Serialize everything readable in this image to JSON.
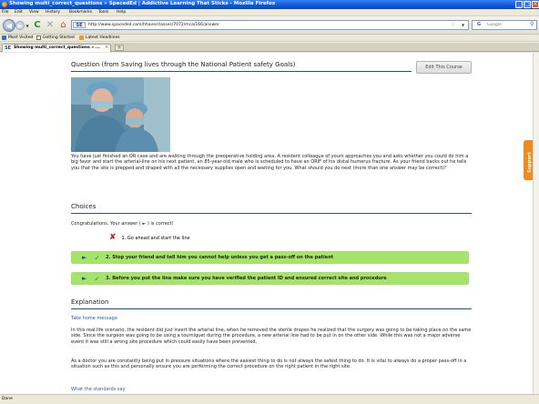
{
  "window": {
    "title": "Showing multi_correct_questions » SpacedEd | Addictive Learning That Sticks - Mozilla Firefox",
    "controls": [
      "_",
      "□",
      "×"
    ]
  },
  "menu": [
    "File",
    "Edit",
    "View",
    "History",
    "Bookmarks",
    "Tools",
    "Help"
  ],
  "nav": {
    "url": "http://www.spaceded.com/hhave/classes/7072/mca/166/answer",
    "site_badge": "SE",
    "search_placeholder": "Google"
  },
  "bookmarks": [
    "Most Visited",
    "Getting Started",
    "Latest Headlines"
  ],
  "tab": {
    "label": "Showing multi_correct_questions » ...",
    "new_tab": "+"
  },
  "page": {
    "question_title": "Question (from Saving lives through the National Patient safety Goals)",
    "edit_button": "Edit This Course",
    "question_text": "You have just finished an OR case and are walking through the preoperative holding area. A resident colleague of yours approaches you and asks whether you could do him a big favor and start the arterial-line on his next patient, an 85-year-old male who is scheduled to have an ORIF of his distal humerus fracture. As your friend backs out he tells you that the site is prepped and draped with all the necessary supplies open and waiting for you. What should you do next (more than one answer may be correct)?",
    "choices_title": "Choices",
    "congrats_before": "Congratulations, Your answer ( ",
    "congrats_marker": "►",
    "congrats_after": " ) is correct!",
    "choices": [
      {
        "label": "1. Go ahead and start the line",
        "status": "incorrect"
      },
      {
        "label": "2. Stop your friend and tell him you cannot help unless you get a pass-off on the patient",
        "status": "correct"
      },
      {
        "label": "3. Before you put the line make sure you have verified the patient ID and ensured correct site and procedure",
        "status": "correct"
      }
    ],
    "explanation_title": "Explanation",
    "take_home_link": "Take home message",
    "explanation_p1": "In this real life scenario, the resident did just insert the arterial line, when he removed the sterile drapes he realized that the surgery was going to be taking place on the same side. Since the surgeon was going to be using a tourniquet during the procedure, a new arterial line had to be put in on the other side. While this was not a major adverse event it was still a wrong site procedure which could easily have been prevented.",
    "explanation_p2": "As a doctor you are constantly being put in pressure situations where the easiest thing to do is not always the safest thing to do. It is vital to always do a proper pass-off in a situation such as this and personally ensure you are performing the correct procedure on the right patient in the right site.",
    "standards_link": "What the standards say",
    "support_tab": "Support"
  },
  "status": "Done",
  "colors": {
    "accent_blue": "#1f4fa6",
    "correct_green": "#a6e36b",
    "support_orange": "#f08a1d",
    "wrong_red": "#cc1111"
  }
}
